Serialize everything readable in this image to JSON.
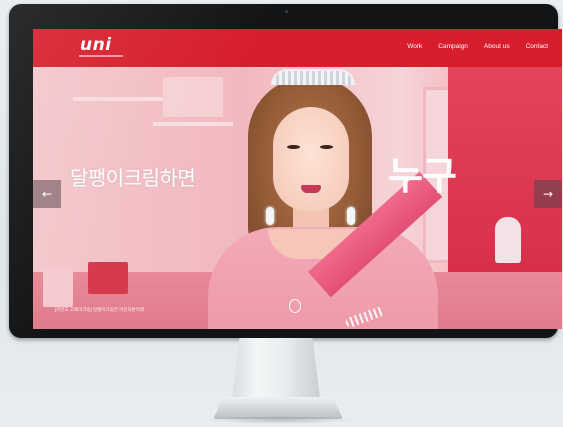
{
  "site": {
    "logo": "uni"
  },
  "nav": {
    "items": [
      "Work",
      "Campaign",
      "About us",
      "Contact"
    ]
  },
  "hero": {
    "headline_left": "달팽이크림하면",
    "headline_right": "누구",
    "caption": "[미인도 고제이크림] 달팽이크림은 미인의판이래",
    "prev_icon": "arrow-left-icon",
    "next_icon": "arrow-right-icon"
  },
  "colors": {
    "nav_bar": "#d81e2c",
    "bezel": "#121416",
    "hero_pink": "#f1b9bf"
  }
}
